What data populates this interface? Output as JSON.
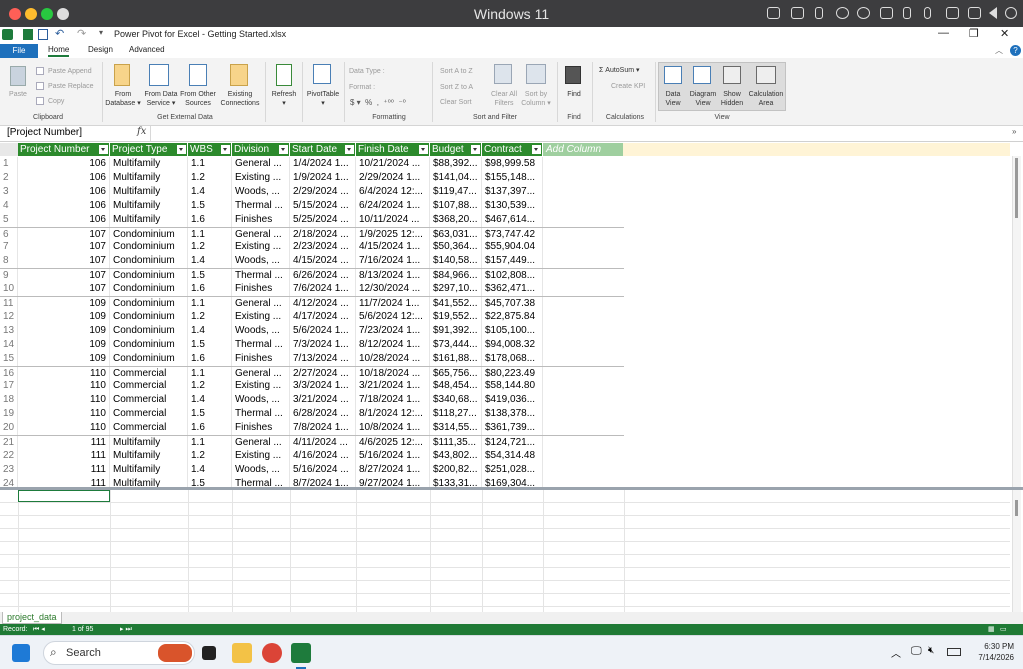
{
  "os": {
    "title": "Windows 11"
  },
  "window": {
    "title": "Power Pivot for Excel - Getting Started.xlsx"
  },
  "tabs": [
    "File",
    "Home",
    "Design",
    "Advanced"
  ],
  "ribbon": {
    "clipboard": {
      "paste": "Paste",
      "paste_append": "Paste Append",
      "paste_replace": "Paste Replace",
      "copy": "Copy",
      "group": "Clipboard"
    },
    "external": {
      "from_database": "From\nDatabase ▾",
      "from_data_service": "From Data\nService ▾",
      "from_other_sources": "From Other\nSources",
      "existing_connections": "Existing\nConnections",
      "group": "Get External Data"
    },
    "refresh": "Refresh\n▾",
    "pivottable": "PivotTable\n▾",
    "formatting": {
      "data_type": "Data Type :",
      "format": "Format :",
      "symbols": "$ ▾  %  ,  ⁺⁰⁰  ⁻⁰",
      "group": "Formatting"
    },
    "sort": {
      "sort_az": "Sort A to Z",
      "sort_za": "Sort Z to A",
      "clear_sort": "Clear Sort",
      "clear_all_filters": "Clear All\nFilters",
      "sort_by_column": "Sort by\nColumn ▾",
      "group": "Sort and Filter"
    },
    "find": {
      "find": "Find",
      "group": "Find"
    },
    "calc": {
      "autosum": "Σ AutoSum ▾",
      "create_kpi": "Create KPI",
      "group": "Calculations"
    },
    "view": {
      "data_view": "Data\nView",
      "diagram_view": "Diagram\nView",
      "show_hidden": "Show\nHidden",
      "calculation_area": "Calculation\nArea",
      "group": "View"
    }
  },
  "formula_bar": {
    "name_box": "[Project Number]",
    "fx": "fx"
  },
  "table": {
    "columns": [
      "Project Number",
      "Project Type",
      "WBS",
      "Division",
      "Start Date",
      "Finish Date",
      "Budget",
      "Contract"
    ],
    "add_column": "Add Column",
    "rows": [
      [
        "1",
        "106",
        "Multifamily",
        "1.1",
        "General ...",
        "1/4/2024 1...",
        "10/21/2024 ...",
        "$88,392...",
        "$98,999.58"
      ],
      [
        "2",
        "106",
        "Multifamily",
        "1.2",
        "Existing ...",
        "1/9/2024 1...",
        "2/29/2024 1...",
        "$141,04...",
        "$155,148..."
      ],
      [
        "3",
        "106",
        "Multifamily",
        "1.4",
        "Woods, ...",
        "2/29/2024 ...",
        "6/4/2024 12:...",
        "$119,47...",
        "$137,397..."
      ],
      [
        "4",
        "106",
        "Multifamily",
        "1.5",
        "Thermal ...",
        "5/15/2024 ...",
        "6/24/2024 1...",
        "$107,88...",
        "$130,539..."
      ],
      [
        "5",
        "106",
        "Multifamily",
        "1.6",
        "Finishes",
        "5/25/2024 ...",
        "10/11/2024 ...",
        "$368,20...",
        "$467,614..."
      ],
      [
        "6",
        "107",
        "Condominium",
        "1.1",
        "General ...",
        "2/18/2024 ...",
        "1/9/2025 12:...",
        "$63,031...",
        "$73,747.42"
      ],
      [
        "7",
        "107",
        "Condominium",
        "1.2",
        "Existing ...",
        "2/23/2024 ...",
        "4/15/2024 1...",
        "$50,364...",
        "$55,904.04"
      ],
      [
        "8",
        "107",
        "Condominium",
        "1.4",
        "Woods, ...",
        "4/15/2024 ...",
        "7/16/2024 1...",
        "$140,58...",
        "$157,449..."
      ],
      [
        "9",
        "107",
        "Condominium",
        "1.5",
        "Thermal ...",
        "6/26/2024 ...",
        "8/13/2024 1...",
        "$84,966...",
        "$102,808..."
      ],
      [
        "10",
        "107",
        "Condominium",
        "1.6",
        "Finishes",
        "7/6/2024 1...",
        "12/30/2024 ...",
        "$297,10...",
        "$362,471..."
      ],
      [
        "11",
        "109",
        "Condominium",
        "1.1",
        "General ...",
        "4/12/2024 ...",
        "11/7/2024 1...",
        "$41,552...",
        "$45,707.38"
      ],
      [
        "12",
        "109",
        "Condominium",
        "1.2",
        "Existing ...",
        "4/17/2024 ...",
        "5/6/2024 12:...",
        "$19,552...",
        "$22,875.84"
      ],
      [
        "13",
        "109",
        "Condominium",
        "1.4",
        "Woods, ...",
        "5/6/2024 1...",
        "7/23/2024 1...",
        "$91,392...",
        "$105,100..."
      ],
      [
        "14",
        "109",
        "Condominium",
        "1.5",
        "Thermal ...",
        "7/3/2024 1...",
        "8/12/2024 1...",
        "$73,444...",
        "$94,008.32"
      ],
      [
        "15",
        "109",
        "Condominium",
        "1.6",
        "Finishes",
        "7/13/2024 ...",
        "10/28/2024 ...",
        "$161,88...",
        "$178,068..."
      ],
      [
        "16",
        "110",
        "Commercial",
        "1.1",
        "General ...",
        "2/27/2024 ...",
        "10/18/2024 ...",
        "$65,756...",
        "$80,223.49"
      ],
      [
        "17",
        "110",
        "Commercial",
        "1.2",
        "Existing ...",
        "3/3/2024 1...",
        "3/21/2024 1...",
        "$48,454...",
        "$58,144.80"
      ],
      [
        "18",
        "110",
        "Commercial",
        "1.4",
        "Woods, ...",
        "3/21/2024 ...",
        "7/18/2024 1...",
        "$340,68...",
        "$419,036..."
      ],
      [
        "19",
        "110",
        "Commercial",
        "1.5",
        "Thermal ...",
        "6/28/2024 ...",
        "8/1/2024 12:...",
        "$118,27...",
        "$138,378..."
      ],
      [
        "20",
        "110",
        "Commercial",
        "1.6",
        "Finishes",
        "7/8/2024 1...",
        "10/8/2024 1...",
        "$314,55...",
        "$361,739..."
      ],
      [
        "21",
        "111",
        "Multifamily",
        "1.1",
        "General ...",
        "4/11/2024 ...",
        "4/6/2025 12:...",
        "$111,35...",
        "$124,721..."
      ],
      [
        "22",
        "111",
        "Multifamily",
        "1.2",
        "Existing ...",
        "4/16/2024 ...",
        "5/16/2024 1...",
        "$43,802...",
        "$54,314.48"
      ],
      [
        "23",
        "111",
        "Multifamily",
        "1.4",
        "Woods, ...",
        "5/16/2024 ...",
        "8/27/2024 1...",
        "$200,82...",
        "$251,028..."
      ],
      [
        "24",
        "111",
        "Multifamily",
        "1.5",
        "Thermal ...",
        "8/7/2024 1...",
        "9/27/2024 1...",
        "$133,31...",
        "$169,304..."
      ]
    ]
  },
  "sheet_tab": "project_data",
  "status": {
    "record_label": "Record:",
    "record_of": "1 of 95"
  },
  "taskbar": {
    "search_placeholder": "Search",
    "time": "6:30 PM",
    "date": "7/14/2026"
  }
}
